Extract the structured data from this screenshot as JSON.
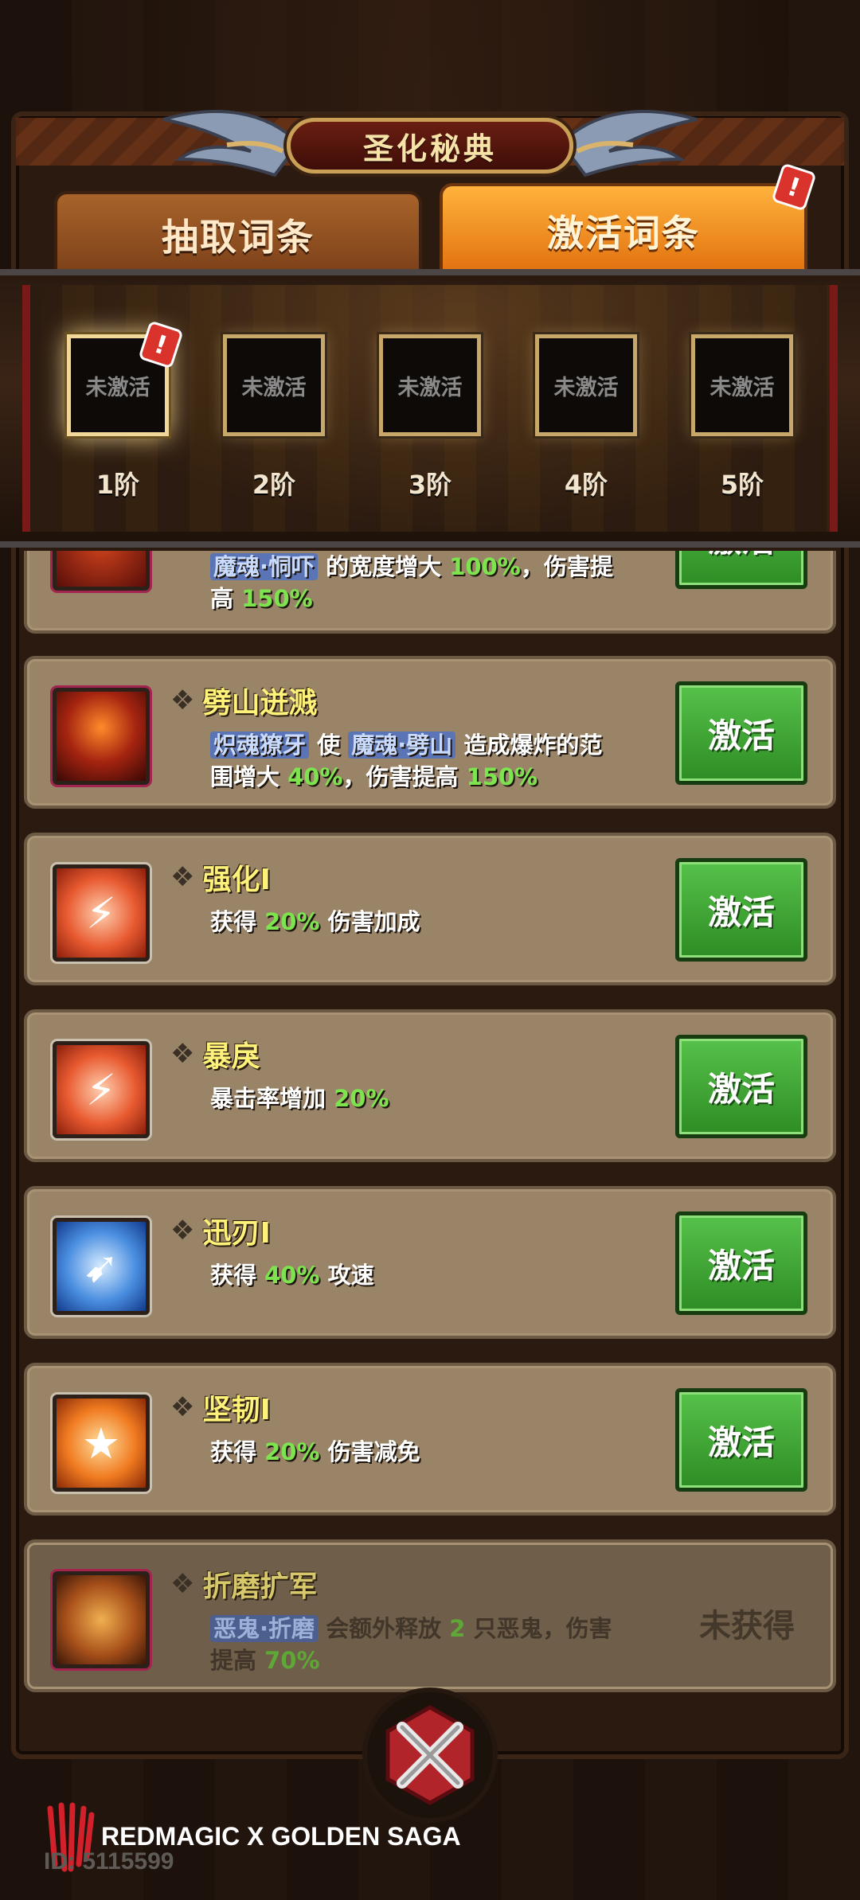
{
  "header": {
    "title": "圣化秘典"
  },
  "tabs": [
    {
      "label": "抽取词条",
      "active": false
    },
    {
      "label": "激活词条",
      "active": true,
      "alert": "!"
    }
  ],
  "tiers": [
    {
      "status": "未激活",
      "label": "1阶",
      "alert": "!"
    },
    {
      "status": "未激活",
      "label": "2阶"
    },
    {
      "status": "未激活",
      "label": "3阶"
    },
    {
      "status": "未激活",
      "label": "4阶"
    },
    {
      "status": "未激活",
      "label": "5阶"
    }
  ],
  "cards": [
    {
      "partial_desc": {
        "skill": "魔魂·恫吓",
        "text1": " 的宽度增大 ",
        "v1": "100%",
        "text2": "，伤害提",
        "text3": "高 ",
        "v2": "150%"
      },
      "button": "激活"
    },
    {
      "name": "劈山迸溅",
      "desc": {
        "s1": "炽魂獠牙",
        "t1": " 使 ",
        "s2": "魔魂·劈山",
        "t2": " 造成爆炸的范",
        "t3": "围增大 ",
        "v1": "40%",
        "t4": "，伤害提高 ",
        "v2": "150%"
      },
      "button": "激活"
    },
    {
      "name": "强化Ⅰ",
      "desc": {
        "t1": "获得 ",
        "v1": "20%",
        "t2": " 伤害加成"
      },
      "button": "激活"
    },
    {
      "name": "暴戾",
      "desc": {
        "t1": "暴击率增加 ",
        "v1": "20%"
      },
      "button": "激活"
    },
    {
      "name": "迅刃Ⅰ",
      "desc": {
        "t1": "获得 ",
        "v1": "40%",
        "t2": " 攻速"
      },
      "button": "激活"
    },
    {
      "name": "坚韧Ⅰ",
      "desc": {
        "t1": "获得 ",
        "v1": "20%",
        "t2": " 伤害减免"
      },
      "button": "激活"
    },
    {
      "name": "折磨扩军",
      "desc": {
        "s1": "恶鬼·折磨",
        "t1": " 会额外释放 ",
        "v1": "2",
        "t2": " 只恶鬼，伤害",
        "t3": "提高 ",
        "v2": "70%"
      },
      "status": "未获得"
    }
  ],
  "footer": {
    "brand": "REDMAGIC X GOLDEN SAGA",
    "uid": "ID: 5115599"
  }
}
